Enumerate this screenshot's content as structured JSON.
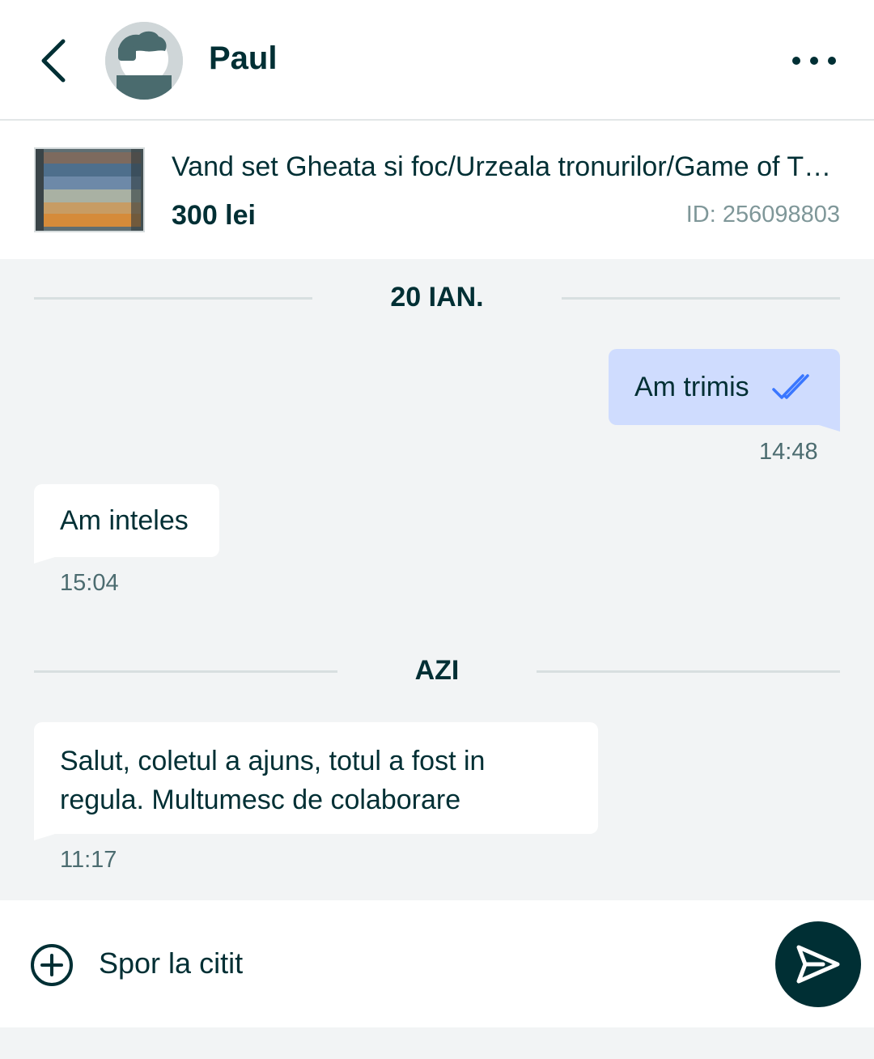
{
  "header": {
    "contact_name": "Paul",
    "back_icon": "chevron-left-icon",
    "more_icon": "more-horizontal-icon",
    "avatar_icon": "user-avatar-icon"
  },
  "product": {
    "title": "Vand set Gheata si foc/Urzeala tronurilor/Game of Thrones",
    "price": "300 lei",
    "id": "ID: 256098803"
  },
  "chat": {
    "separators": [
      {
        "label": "20 IAN."
      },
      {
        "label": "AZI"
      }
    ],
    "messages": [
      {
        "direction": "out",
        "text": "Am trimis",
        "time": "14:48",
        "status_icon": "double-check-icon"
      },
      {
        "direction": "in",
        "text": "Am inteles",
        "time": "15:04"
      },
      {
        "direction": "in",
        "text": "Salut, coletul a ajuns, totul a fost in regula. Multumesc de colaborare",
        "time": "11:17"
      }
    ]
  },
  "composer": {
    "value": "Spor la citit",
    "add_icon": "plus-circle-icon",
    "send_icon": "send-icon"
  },
  "colors": {
    "brand_dark": "#002f34",
    "outgoing_bubble": "#cfdcfe",
    "incoming_bubble": "#ffffff",
    "chat_background": "#f2f4f5",
    "read_check": "#3a77ff"
  }
}
